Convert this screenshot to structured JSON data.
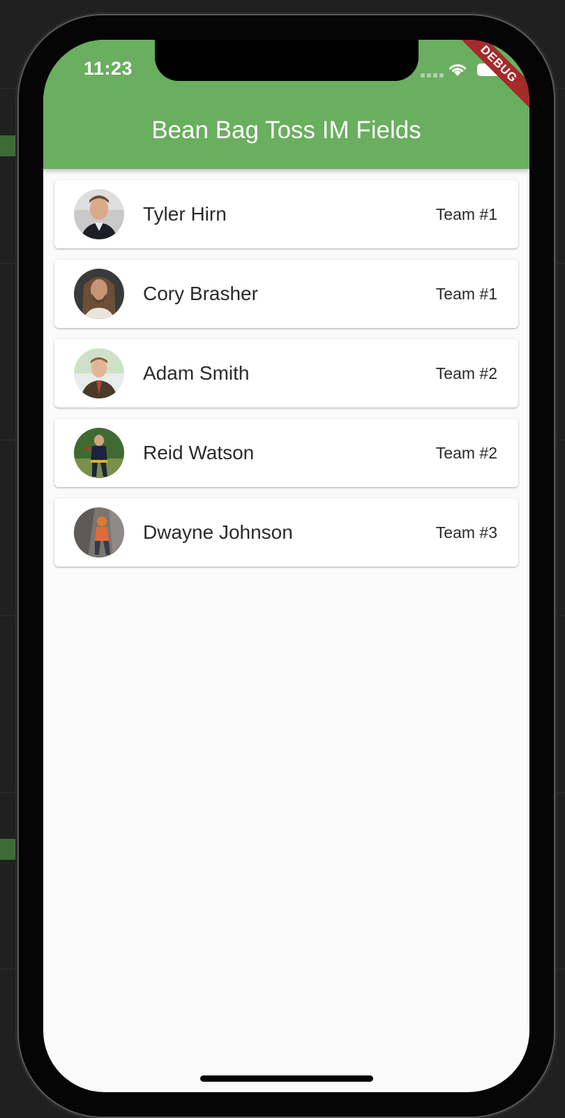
{
  "status_bar": {
    "time": "11:23"
  },
  "debug_banner": "DEBUG",
  "app_bar": {
    "title": "Bean Bag Toss IM Fields",
    "color": "#6aae5f"
  },
  "players": [
    {
      "name": "Tyler Hirn",
      "team": "Team #1",
      "avatar_icon": "player-photo"
    },
    {
      "name": "Cory Brasher",
      "team": "Team #1",
      "avatar_icon": "player-photo"
    },
    {
      "name": "Adam Smith",
      "team": "Team #2",
      "avatar_icon": "player-photo"
    },
    {
      "name": "Reid Watson",
      "team": "Team #2",
      "avatar_icon": "player-photo"
    },
    {
      "name": "Dwayne Johnson",
      "team": "Team #3",
      "avatar_icon": "player-photo"
    }
  ]
}
